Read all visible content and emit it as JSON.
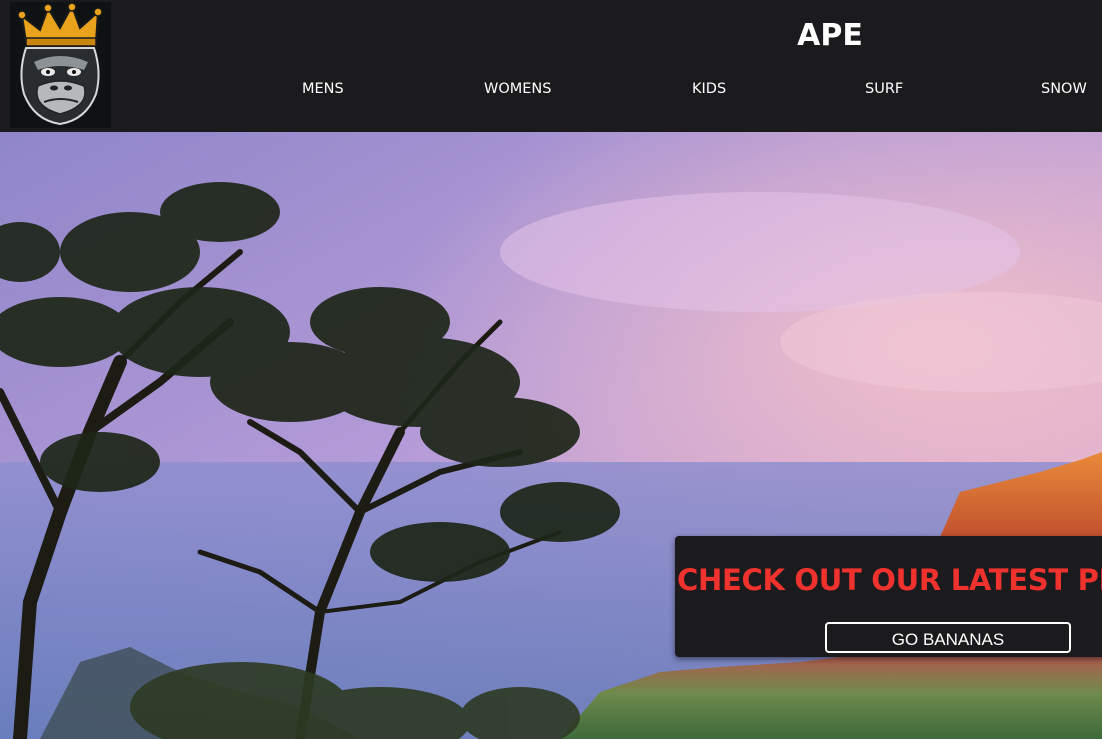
{
  "header": {
    "brand": "APE",
    "logo_icon": "crowned-gorilla-logo",
    "nav": [
      {
        "label": "MENS"
      },
      {
        "label": "WOMENS"
      },
      {
        "label": "KIDS"
      },
      {
        "label": "SURF"
      },
      {
        "label": "SNOW"
      }
    ]
  },
  "hero": {
    "image": "coastal-cliffs-sunset-with-trees"
  },
  "promo": {
    "headline": "CHECK OUT OUR LATEST PRODUCTS",
    "button_label": "GO BANANAS"
  },
  "colors": {
    "header_bg": "#1b1a1c",
    "nav_text": "#ffffff",
    "promo_headline": "#f0322f",
    "crown_gold": "#e8a21c"
  }
}
